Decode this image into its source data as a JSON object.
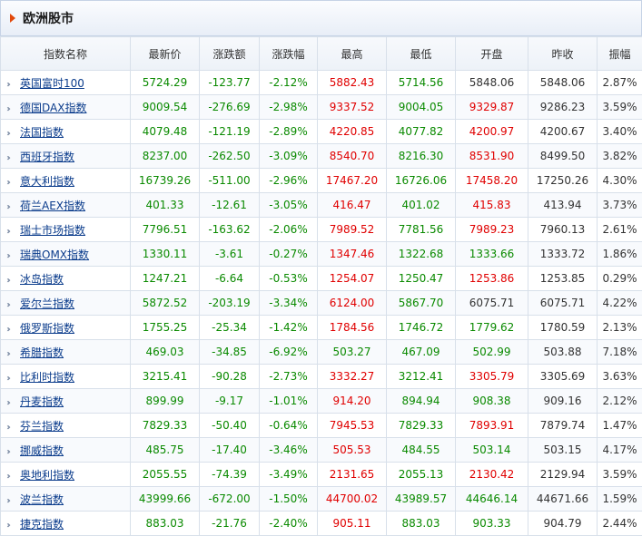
{
  "panel": {
    "title": "欧洲股市"
  },
  "colors": {
    "down": "#0a8a00",
    "up": "#e00000",
    "accent": "#e2480a"
  },
  "table": {
    "headers": [
      "指数名称",
      "最新价",
      "涨跌额",
      "涨跌幅",
      "最高",
      "最低",
      "开盘",
      "昨收",
      "振幅"
    ],
    "rows": [
      {
        "name": "英国富时100",
        "latest": "5724.29",
        "change": "-123.77",
        "change_pct": "-2.12%",
        "high": "5882.43",
        "low": "5714.56",
        "open": "5848.06",
        "prev_close": "5848.06",
        "amplitude": "2.87%",
        "high_c": "up",
        "low_c": "down",
        "open_c": "flat"
      },
      {
        "name": "德国DAX指数",
        "latest": "9009.54",
        "change": "-276.69",
        "change_pct": "-2.98%",
        "high": "9337.52",
        "low": "9004.05",
        "open": "9329.87",
        "prev_close": "9286.23",
        "amplitude": "3.59%",
        "high_c": "up",
        "low_c": "down",
        "open_c": "up"
      },
      {
        "name": "法国指数",
        "latest": "4079.48",
        "change": "-121.19",
        "change_pct": "-2.89%",
        "high": "4220.85",
        "low": "4077.82",
        "open": "4200.97",
        "prev_close": "4200.67",
        "amplitude": "3.40%",
        "high_c": "up",
        "low_c": "down",
        "open_c": "up"
      },
      {
        "name": "西班牙指数",
        "latest": "8237.00",
        "change": "-262.50",
        "change_pct": "-3.09%",
        "high": "8540.70",
        "low": "8216.30",
        "open": "8531.90",
        "prev_close": "8499.50",
        "amplitude": "3.82%",
        "high_c": "up",
        "low_c": "down",
        "open_c": "up"
      },
      {
        "name": "意大利指数",
        "latest": "16739.26",
        "change": "-511.00",
        "change_pct": "-2.96%",
        "high": "17467.20",
        "low": "16726.06",
        "open": "17458.20",
        "prev_close": "17250.26",
        "amplitude": "4.30%",
        "high_c": "up",
        "low_c": "down",
        "open_c": "up"
      },
      {
        "name": "荷兰AEX指数",
        "latest": "401.33",
        "change": "-12.61",
        "change_pct": "-3.05%",
        "high": "416.47",
        "low": "401.02",
        "open": "415.83",
        "prev_close": "413.94",
        "amplitude": "3.73%",
        "high_c": "up",
        "low_c": "down",
        "open_c": "up"
      },
      {
        "name": "瑞士市场指数",
        "latest": "7796.51",
        "change": "-163.62",
        "change_pct": "-2.06%",
        "high": "7989.52",
        "low": "7781.56",
        "open": "7989.23",
        "prev_close": "7960.13",
        "amplitude": "2.61%",
        "high_c": "up",
        "low_c": "down",
        "open_c": "up"
      },
      {
        "name": "瑞典OMX指数",
        "latest": "1330.11",
        "change": "-3.61",
        "change_pct": "-0.27%",
        "high": "1347.46",
        "low": "1322.68",
        "open": "1333.66",
        "prev_close": "1333.72",
        "amplitude": "1.86%",
        "high_c": "up",
        "low_c": "down",
        "open_c": "down"
      },
      {
        "name": "冰岛指数",
        "latest": "1247.21",
        "change": "-6.64",
        "change_pct": "-0.53%",
        "high": "1254.07",
        "low": "1250.47",
        "open": "1253.86",
        "prev_close": "1253.85",
        "amplitude": "0.29%",
        "high_c": "up",
        "low_c": "down",
        "open_c": "up"
      },
      {
        "name": "爱尔兰指数",
        "latest": "5872.52",
        "change": "-203.19",
        "change_pct": "-3.34%",
        "high": "6124.00",
        "low": "5867.70",
        "open": "6075.71",
        "prev_close": "6075.71",
        "amplitude": "4.22%",
        "high_c": "up",
        "low_c": "down",
        "open_c": "flat"
      },
      {
        "name": "俄罗斯指数",
        "latest": "1755.25",
        "change": "-25.34",
        "change_pct": "-1.42%",
        "high": "1784.56",
        "low": "1746.72",
        "open": "1779.62",
        "prev_close": "1780.59",
        "amplitude": "2.13%",
        "high_c": "up",
        "low_c": "down",
        "open_c": "down"
      },
      {
        "name": "希腊指数",
        "latest": "469.03",
        "change": "-34.85",
        "change_pct": "-6.92%",
        "high": "503.27",
        "low": "467.09",
        "open": "502.99",
        "prev_close": "503.88",
        "amplitude": "7.18%",
        "high_c": "down",
        "low_c": "down",
        "open_c": "down"
      },
      {
        "name": "比利时指数",
        "latest": "3215.41",
        "change": "-90.28",
        "change_pct": "-2.73%",
        "high": "3332.27",
        "low": "3212.41",
        "open": "3305.79",
        "prev_close": "3305.69",
        "amplitude": "3.63%",
        "high_c": "up",
        "low_c": "down",
        "open_c": "up"
      },
      {
        "name": "丹麦指数",
        "latest": "899.99",
        "change": "-9.17",
        "change_pct": "-1.01%",
        "high": "914.20",
        "low": "894.94",
        "open": "908.38",
        "prev_close": "909.16",
        "amplitude": "2.12%",
        "high_c": "up",
        "low_c": "down",
        "open_c": "down"
      },
      {
        "name": "芬兰指数",
        "latest": "7829.33",
        "change": "-50.40",
        "change_pct": "-0.64%",
        "high": "7945.53",
        "low": "7829.33",
        "open": "7893.91",
        "prev_close": "7879.74",
        "amplitude": "1.47%",
        "high_c": "up",
        "low_c": "down",
        "open_c": "up"
      },
      {
        "name": "挪威指数",
        "latest": "485.75",
        "change": "-17.40",
        "change_pct": "-3.46%",
        "high": "505.53",
        "low": "484.55",
        "open": "503.14",
        "prev_close": "503.15",
        "amplitude": "4.17%",
        "high_c": "up",
        "low_c": "down",
        "open_c": "down"
      },
      {
        "name": "奥地利指数",
        "latest": "2055.55",
        "change": "-74.39",
        "change_pct": "-3.49%",
        "high": "2131.65",
        "low": "2055.13",
        "open": "2130.42",
        "prev_close": "2129.94",
        "amplitude": "3.59%",
        "high_c": "up",
        "low_c": "down",
        "open_c": "up"
      },
      {
        "name": "波兰指数",
        "latest": "43999.66",
        "change": "-672.00",
        "change_pct": "-1.50%",
        "high": "44700.02",
        "low": "43989.57",
        "open": "44646.14",
        "prev_close": "44671.66",
        "amplitude": "1.59%",
        "high_c": "up",
        "low_c": "down",
        "open_c": "down"
      },
      {
        "name": "捷克指数",
        "latest": "883.03",
        "change": "-21.76",
        "change_pct": "-2.40%",
        "high": "905.11",
        "low": "883.03",
        "open": "903.33",
        "prev_close": "904.79",
        "amplitude": "2.44%",
        "high_c": "up",
        "low_c": "down",
        "open_c": "down"
      }
    ]
  }
}
